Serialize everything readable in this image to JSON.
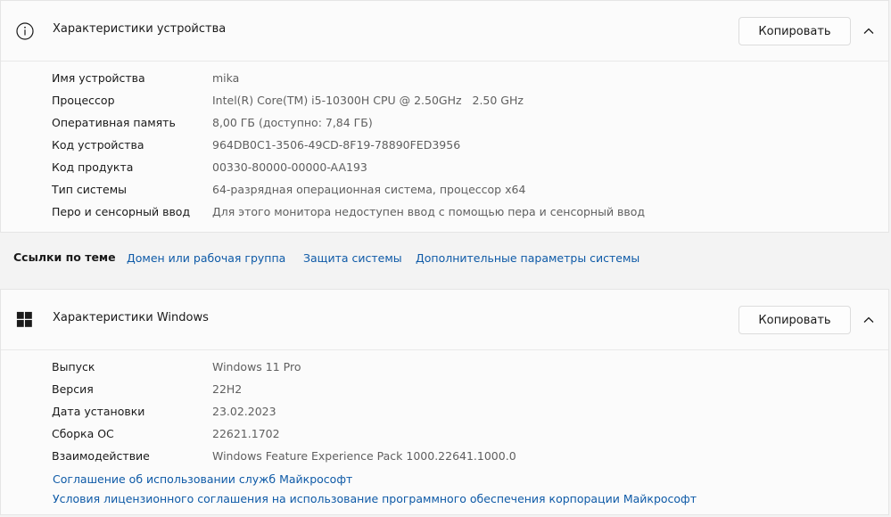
{
  "device": {
    "title": "Характеристики устройства",
    "copy_label": "Копировать",
    "rows": [
      {
        "label": "Имя устройства",
        "value": "mika"
      },
      {
        "label": "Процессор",
        "value": "Intel(R) Core(TM) i5-10300H CPU @ 2.50GHz   2.50 GHz"
      },
      {
        "label": "Оперативная память",
        "value": "8,00 ГБ (доступно: 7,84 ГБ)"
      },
      {
        "label": "Код устройства",
        "value": "964DB0C1-3506-49CD-8F19-78890FED3956"
      },
      {
        "label": "Код продукта",
        "value": "00330-80000-00000-AA193"
      },
      {
        "label": "Тип системы",
        "value": "64-разрядная операционная система, процессор x64"
      },
      {
        "label": "Перо и сенсорный ввод",
        "value": "Для этого монитора недоступен ввод с помощью пера и сенсорный ввод"
      }
    ]
  },
  "related": {
    "title": "Ссылки по теме",
    "links": [
      "Домен или рабочая группа",
      "Защита системы",
      "Дополнительные параметры системы"
    ]
  },
  "windows": {
    "title": "Характеристики Windows",
    "copy_label": "Копировать",
    "rows": [
      {
        "label": "Выпуск",
        "value": "Windows 11 Pro"
      },
      {
        "label": "Версия",
        "value": "22H2"
      },
      {
        "label": "Дата установки",
        "value": "23.02.2023"
      },
      {
        "label": "Сборка ОС",
        "value": "22621.1702"
      },
      {
        "label": "Взаимодействие",
        "value": "Windows Feature Experience Pack 1000.22641.1000.0"
      }
    ],
    "links": [
      "Соглашение об использовании служб Майкрософт",
      "Условия лицензионного соглашения на использование программного обеспечения корпорации Майкрософт"
    ]
  },
  "colors": {
    "accent_link": "#0e5aa7",
    "value_text": "#5f5f5f",
    "background": "#f3f3f3",
    "card": "#fbfbfb"
  },
  "icons": {
    "device_header": "info-circle-icon",
    "windows_header": "windows-logo-icon",
    "collapse": "chevron-up-icon"
  }
}
